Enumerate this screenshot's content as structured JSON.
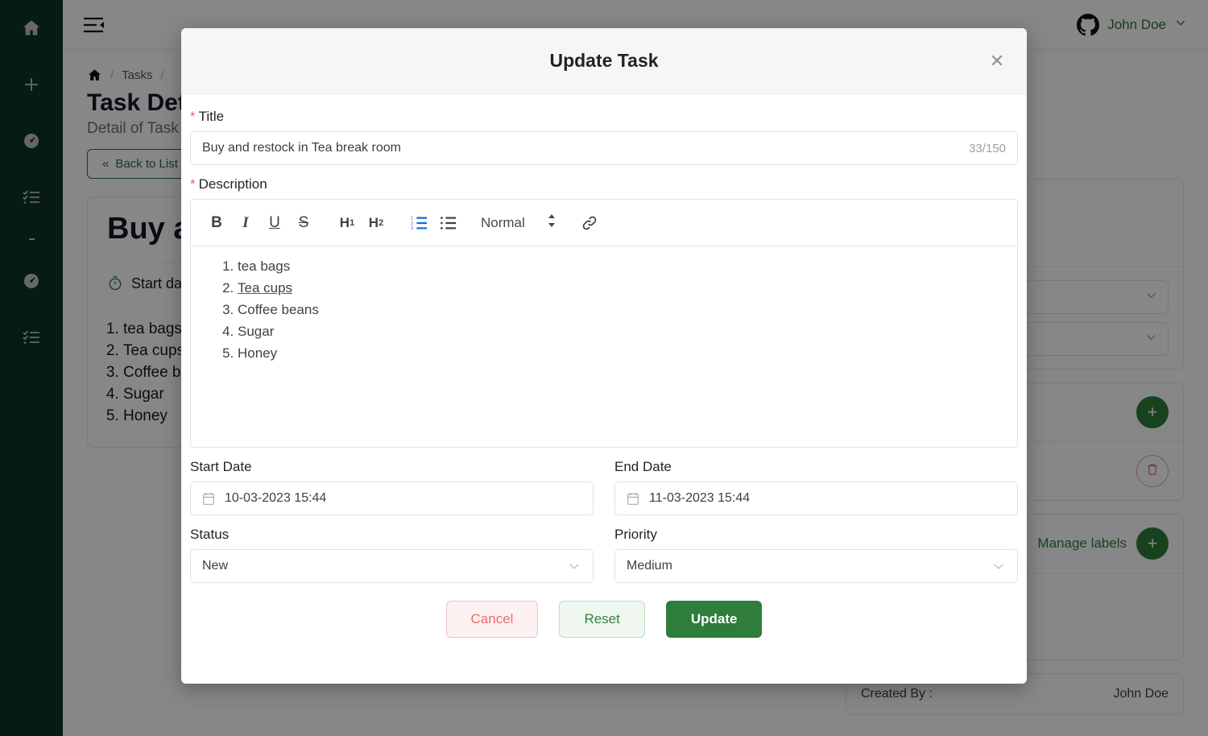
{
  "sidebar": {
    "items": [
      {
        "icon": "home-icon",
        "name": "rail-item-home"
      },
      {
        "icon": "plus-icon",
        "name": "rail-item-add"
      },
      {
        "icon": "dashboard-icon",
        "name": "rail-item-dashboard"
      },
      {
        "icon": "tasks-icon",
        "name": "rail-item-tasks"
      },
      {
        "icon": "dot-icon",
        "name": "rail-item-divider"
      },
      {
        "icon": "dashboard-icon",
        "name": "rail-item-dashboard-2"
      },
      {
        "icon": "tasks-icon",
        "name": "rail-item-tasks-2"
      }
    ]
  },
  "topbar": {
    "menu_icon": "hamburger-collapse-icon",
    "brand_icon": "github-icon",
    "user_name": "John Doe",
    "user_caret": "chevron-down-icon"
  },
  "background": {
    "breadcrumb": {
      "home_icon": "home-icon",
      "sep": "/",
      "items": [
        "Tasks"
      ]
    },
    "page_title": "Task Details",
    "page_subtitle": "Detail of Task",
    "back_button": "Back to List",
    "back_icon": "double-chevron-left-icon",
    "task_title": "Buy and restock in Tea break room",
    "start_date_label": "Start date",
    "clock_icon": "stopwatch-icon",
    "description_items": [
      "tea bags",
      "Tea cups",
      "Coffee beans",
      "Sugar",
      "Honey"
    ],
    "manage_labels": "Manage labels",
    "add_icon": "plus-icon",
    "delete_icon": "trash-icon",
    "created_by_label": "Created By :",
    "created_by_value": "John Doe"
  },
  "modal": {
    "title": "Update Task",
    "close_icon": "close-icon",
    "title_field": {
      "label": "Title",
      "required": true,
      "value": "Buy and restock in Tea break room",
      "counter": "33/150"
    },
    "description_field": {
      "label": "Description",
      "required": true,
      "toolbar": [
        {
          "name": "bold-icon",
          "glyph": "B",
          "active": false
        },
        {
          "name": "italic-icon",
          "glyph": "I",
          "active": false
        },
        {
          "name": "underline-icon",
          "glyph": "U",
          "active": false
        },
        {
          "name": "strikethrough-icon",
          "glyph": "S",
          "active": false
        },
        {
          "name": "heading-1-icon",
          "glyph": "H1",
          "active": false
        },
        {
          "name": "heading-2-icon",
          "glyph": "H2",
          "active": false
        },
        {
          "name": "ordered-list-icon",
          "glyph": "OL",
          "active": true
        },
        {
          "name": "bullet-list-icon",
          "glyph": "UL",
          "active": false
        }
      ],
      "format_select": "Normal",
      "format_caret_icon": "up-down-arrow-icon",
      "link_icon": "link-icon",
      "list_items": [
        {
          "text": "tea bags",
          "underlined": false
        },
        {
          "text": "Tea cups",
          "underlined": true
        },
        {
          "text": "Coffee beans",
          "underlined": false
        },
        {
          "text": "Sugar",
          "underlined": false
        },
        {
          "text": "Honey",
          "underlined": false
        }
      ]
    },
    "start_date": {
      "label": "Start Date",
      "value": "10-03-2023 15:44",
      "icon": "calendar-icon"
    },
    "end_date": {
      "label": "End Date",
      "value": "11-03-2023 15:44",
      "icon": "calendar-icon"
    },
    "status": {
      "label": "Status",
      "value": "New",
      "caret_icon": "chevron-down-icon"
    },
    "priority": {
      "label": "Priority",
      "value": "Medium",
      "caret_icon": "chevron-down-icon"
    },
    "buttons": {
      "cancel": "Cancel",
      "reset": "Reset",
      "update": "Update"
    }
  },
  "colors": {
    "brand_green": "#2f7d3a",
    "rail_dark": "#09241c",
    "danger_red": "#f06a6a",
    "toolbar_active_blue": "#1170d4"
  }
}
